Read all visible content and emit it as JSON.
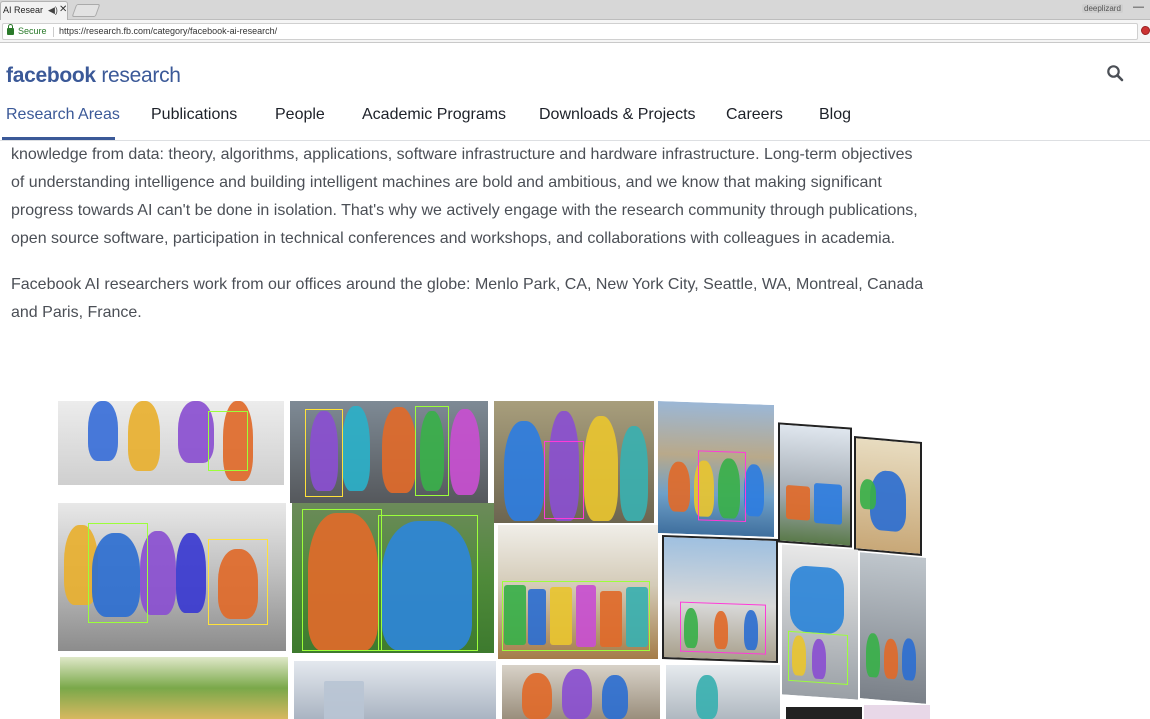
{
  "browser": {
    "tab_title": "AI Research",
    "profile": "deeplizard",
    "secure_label": "Secure",
    "url": "https://research.fb.com/category/facebook-ai-research/"
  },
  "header": {
    "logo_facebook": "facebook",
    "logo_research": "research"
  },
  "nav": {
    "items": [
      "Research Areas",
      "Publications",
      "People",
      "Academic Programs",
      "Downloads & Projects",
      "Careers",
      "Blog"
    ],
    "active": "Research Areas"
  },
  "content": {
    "paragraph1": "knowledge from data: theory, algorithms, applications, software infrastructure and hardware infrastructure. Long-term objectives of understanding intelligence and building intelligent machines are bold and ambitious, and we know that making significant progress towards AI can't be done in isolation. That's why we actively engage with the research community through publications, open source software, participation in technical conferences and workshops, and collaborations with colleagues in academia.",
    "paragraph2": "Facebook AI researchers work from our offices around the globe: Menlo Park, CA, New York City, Seattle, WA, Montreal, Canada and Paris, France."
  },
  "colors": {
    "brand": "#3b5998",
    "text": "#4b4f56",
    "nav_text": "#1d2129"
  }
}
